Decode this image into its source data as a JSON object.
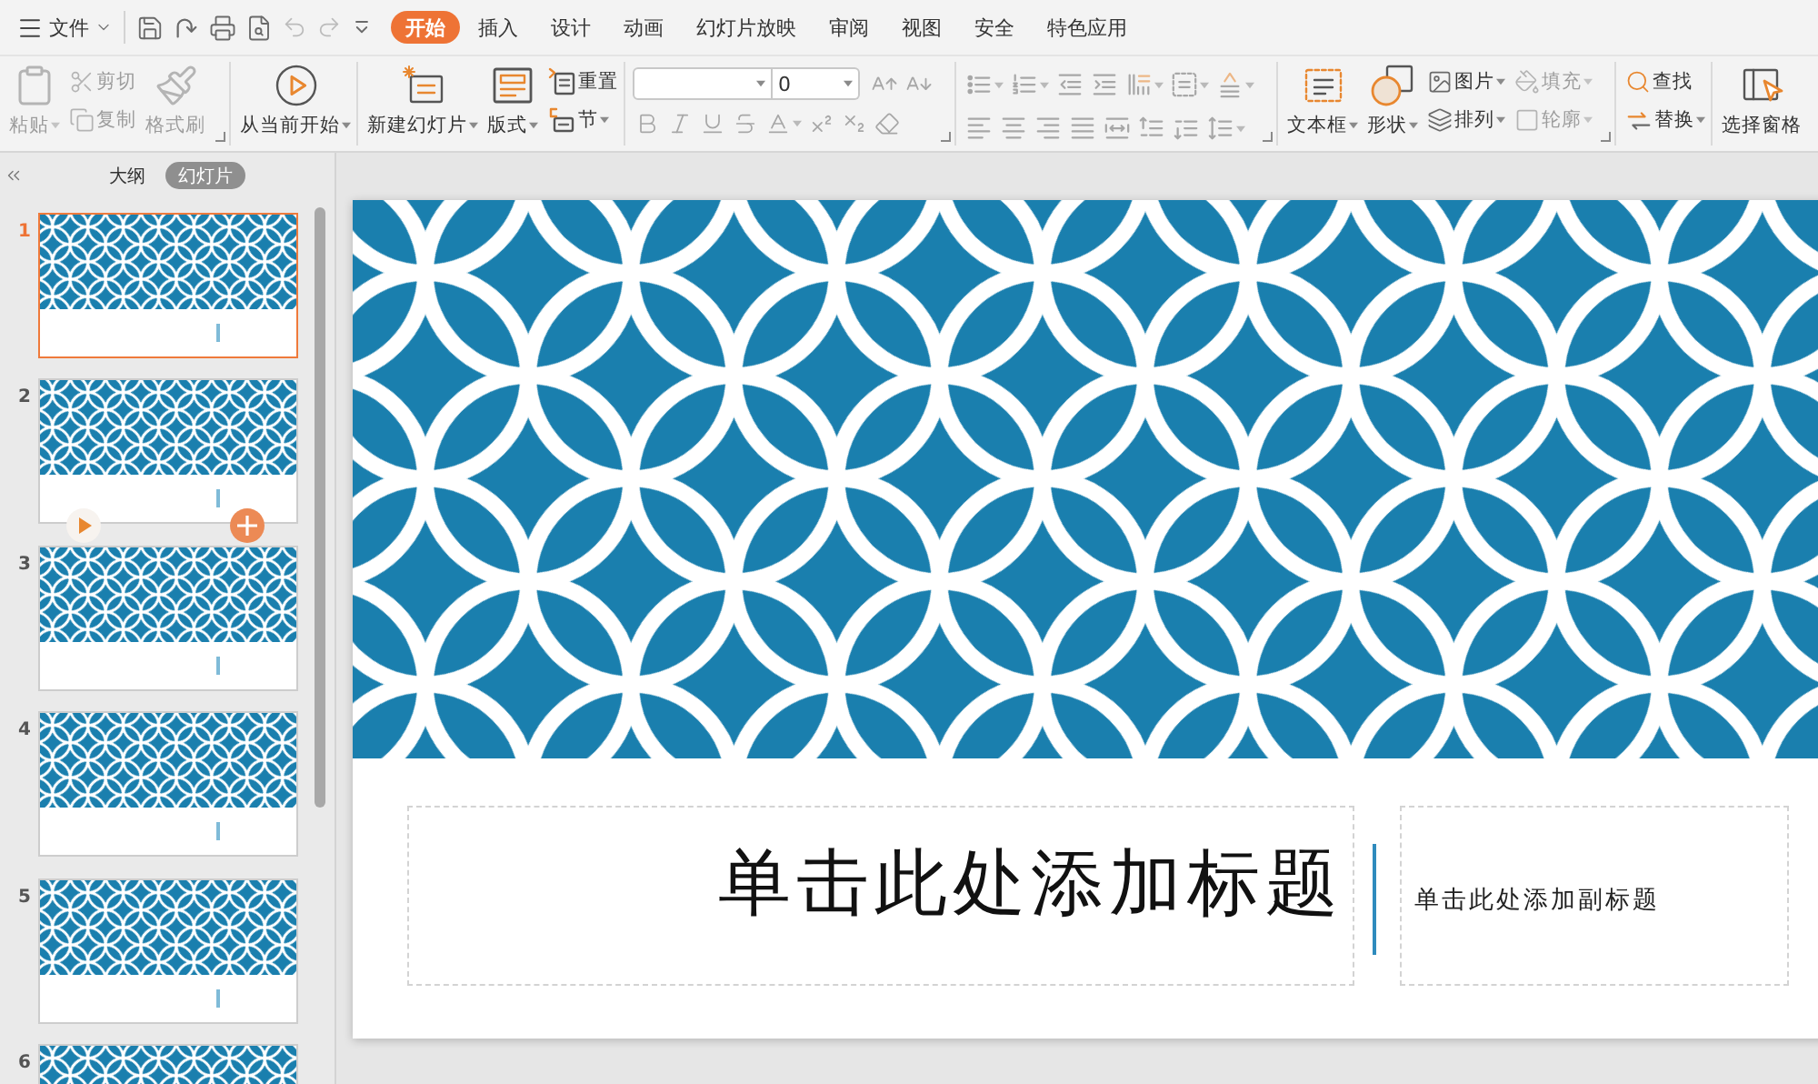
{
  "menu_bar": {
    "file_label": "文件",
    "quick_tools": [
      {
        "kind": "save",
        "disabled": false
      },
      {
        "kind": "curved-arrow",
        "disabled": false
      },
      {
        "kind": "print",
        "disabled": false
      },
      {
        "kind": "print-preview",
        "disabled": false
      },
      {
        "kind": "undo",
        "disabled": true
      },
      {
        "kind": "redo",
        "disabled": true
      },
      {
        "kind": "customize",
        "disabled": false
      }
    ],
    "tabs": [
      {
        "label": "开始",
        "selected": true
      },
      {
        "label": "插入",
        "selected": false
      },
      {
        "label": "设计",
        "selected": false
      },
      {
        "label": "动画",
        "selected": false
      },
      {
        "label": "幻灯片放映",
        "selected": false
      },
      {
        "label": "审阅",
        "selected": false
      },
      {
        "label": "视图",
        "selected": false
      },
      {
        "label": "安全",
        "selected": false
      },
      {
        "label": "特色应用",
        "selected": false
      }
    ]
  },
  "ribbon": [
    {
      "kind": "buttons",
      "launcher": true,
      "columns": [
        [
          {
            "kind": "paste",
            "label": "粘贴",
            "dropdown": true,
            "disabled": true
          }
        ],
        [
          {
            "kind": "cut",
            "label": "剪切",
            "dropdown": false,
            "disabled": true
          },
          {
            "kind": "copy",
            "label": "复制",
            "dropdown": false,
            "disabled": true
          }
        ],
        [
          {
            "kind": "format-painter",
            "label": "格式刷",
            "dropdown": false,
            "disabled": true
          }
        ]
      ]
    },
    {
      "kind": "buttons",
      "launcher": false,
      "columns": [
        [
          {
            "kind": "play",
            "label": "从当前开始",
            "dropdown": true,
            "disabled": false
          }
        ]
      ]
    },
    {
      "kind": "buttons",
      "launcher": false,
      "columns": [
        [
          {
            "kind": "new-slide",
            "label": "新建幻灯片",
            "dropdown": true,
            "disabled": false
          }
        ],
        [
          {
            "kind": "layout",
            "label": "版式",
            "dropdown": true,
            "disabled": false
          }
        ],
        [
          {
            "kind": "reset",
            "label": "重置",
            "dropdown": false,
            "disabled": false
          },
          {
            "kind": "section",
            "label": "节",
            "dropdown": true,
            "disabled": false
          }
        ]
      ]
    },
    {
      "kind": "font",
      "launcher": true,
      "font_size": "0",
      "rows": [
        [
          {
            "kind": "font-grow",
            "dropdown": false,
            "disabled": true
          },
          {
            "kind": "font-shrink",
            "dropdown": false,
            "disabled": true
          }
        ],
        [
          {
            "kind": "bold",
            "dropdown": false,
            "disabled": true
          },
          {
            "kind": "italic",
            "dropdown": false,
            "disabled": true
          },
          {
            "kind": "underline",
            "dropdown": false,
            "disabled": true
          },
          {
            "kind": "strikethrough",
            "dropdown": false,
            "disabled": true
          },
          {
            "kind": "font-color",
            "dropdown": true,
            "disabled": true
          },
          {
            "kind": "superscript",
            "dropdown": false,
            "disabled": true
          },
          {
            "kind": "subscript",
            "dropdown": false,
            "disabled": true
          },
          {
            "kind": "eraser",
            "dropdown": false,
            "disabled": true
          }
        ]
      ]
    },
    {
      "kind": "paragraph",
      "launcher": true,
      "rows": [
        [
          {
            "kind": "bullets",
            "dropdown": true,
            "disabled": true
          },
          {
            "kind": "numbering",
            "dropdown": true,
            "disabled": true
          },
          {
            "kind": "outdent",
            "dropdown": false,
            "disabled": true
          },
          {
            "kind": "indent",
            "dropdown": false,
            "disabled": true
          },
          {
            "kind": "text-direction",
            "dropdown": true,
            "disabled": true
          },
          {
            "kind": "align-text",
            "dropdown": true,
            "disabled": true
          },
          {
            "kind": "paragraph-spacing",
            "dropdown": true,
            "disabled": true
          }
        ],
        [
          {
            "kind": "align-left",
            "dropdown": false,
            "disabled": true
          },
          {
            "kind": "align-center",
            "dropdown": false,
            "disabled": true
          },
          {
            "kind": "align-right",
            "dropdown": false,
            "disabled": true
          },
          {
            "kind": "justify",
            "dropdown": false,
            "disabled": true
          },
          {
            "kind": "distribute",
            "dropdown": false,
            "disabled": true
          },
          {
            "kind": "spacing-before",
            "dropdown": false,
            "disabled": true
          },
          {
            "kind": "spacing-after",
            "dropdown": false,
            "disabled": true
          },
          {
            "kind": "line-spacing",
            "dropdown": true,
            "disabled": true
          }
        ]
      ]
    },
    {
      "kind": "buttons",
      "launcher": true,
      "columns": [
        [
          {
            "kind": "textbox",
            "label": "文本框",
            "dropdown": true,
            "disabled": false
          }
        ],
        [
          {
            "kind": "shape",
            "label": "形状",
            "dropdown": true,
            "disabled": false
          }
        ],
        [
          {
            "kind": "picture",
            "label": "图片",
            "dropdown": true,
            "disabled": false
          },
          {
            "kind": "arrange",
            "label": "排列",
            "dropdown": true,
            "disabled": false
          }
        ],
        [
          {
            "kind": "fill",
            "label": "填充",
            "dropdown": true,
            "disabled": true
          },
          {
            "kind": "outline",
            "label": "轮廓",
            "dropdown": true,
            "disabled": true
          }
        ]
      ]
    },
    {
      "kind": "buttons",
      "launcher": false,
      "columns": [
        [
          {
            "kind": "find",
            "label": "查找",
            "dropdown": false,
            "disabled": false
          },
          {
            "kind": "replace",
            "label": "替换",
            "dropdown": true,
            "disabled": false
          }
        ]
      ]
    },
    {
      "kind": "buttons",
      "launcher": false,
      "columns": [
        [
          {
            "kind": "selection-pane",
            "label": "选择窗格",
            "dropdown": false,
            "disabled": false
          }
        ]
      ]
    }
  ],
  "slide_panel": {
    "tabs": [
      {
        "label": "大纲",
        "selected": false
      },
      {
        "label": "幻灯片",
        "selected": true
      }
    ],
    "slides": [
      {
        "number": "1",
        "selected": true,
        "hovered": false
      },
      {
        "number": "2",
        "selected": false,
        "hovered": true
      },
      {
        "number": "3",
        "selected": false,
        "hovered": false
      },
      {
        "number": "4",
        "selected": false,
        "hovered": false
      },
      {
        "number": "5",
        "selected": false,
        "hovered": false
      },
      {
        "number": "6",
        "selected": false,
        "hovered": false
      }
    ]
  },
  "slide": {
    "title": "单击此处添加标题",
    "subtitle": "单击此处添加副标题"
  }
}
